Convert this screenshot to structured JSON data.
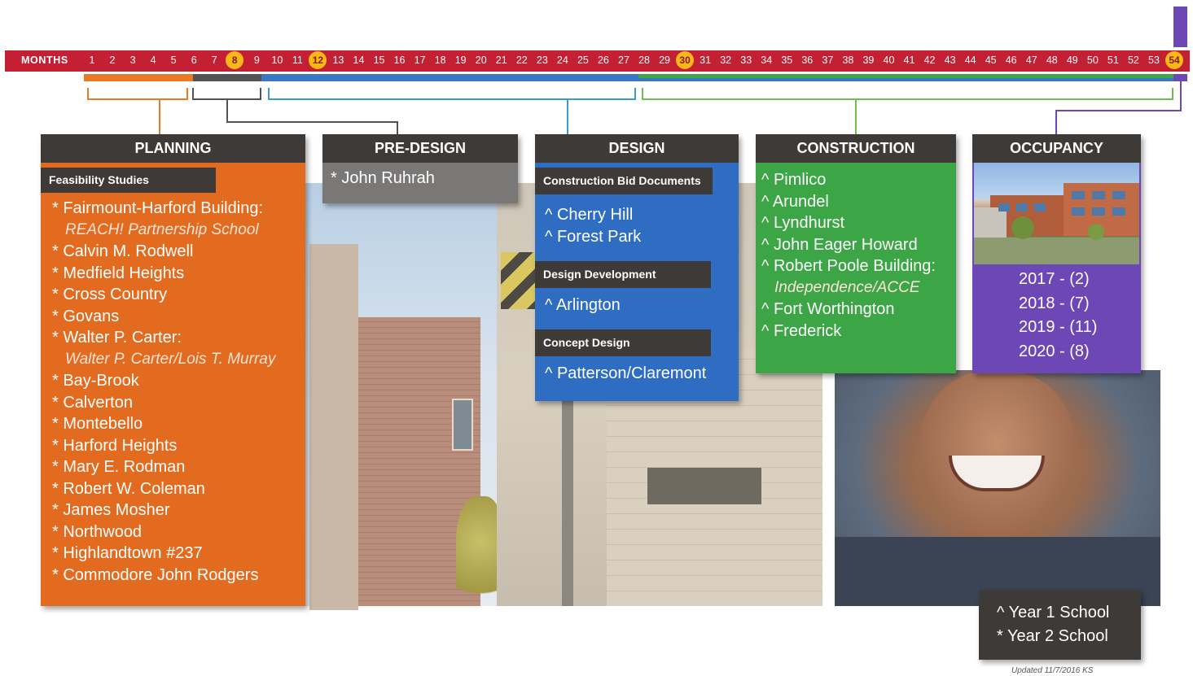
{
  "timeline": {
    "phases": [
      {
        "title": "PLANNING",
        "duration": "8 months",
        "color": "#ea7b24"
      },
      {
        "title": "PRE-DESIGN",
        "duration": "2-4 months",
        "color": "#545252"
      },
      {
        "title": "DESIGN",
        "duration": "12-18 months",
        "color": "#3a78c6"
      },
      {
        "title": "CONSTRUCTION - OCCUPANCY",
        "duration": "18-24 months",
        "color": "#3fa845"
      }
    ],
    "months_label": "MONTHS",
    "months": [
      "1",
      "2",
      "3",
      "4",
      "5",
      "6",
      "7",
      "8",
      "9",
      "10",
      "11",
      "12",
      "13",
      "14",
      "15",
      "16",
      "17",
      "18",
      "19",
      "20",
      "21",
      "22",
      "23",
      "24",
      "25",
      "26",
      "27",
      "28",
      "29",
      "30",
      "31",
      "32",
      "33",
      "34",
      "35",
      "36",
      "37",
      "38",
      "39",
      "40",
      "41",
      "42",
      "43",
      "44",
      "45",
      "46",
      "47",
      "48",
      "49",
      "50",
      "51",
      "52",
      "53",
      "54"
    ],
    "highlighted_months": [
      "8",
      "12",
      "30",
      "54"
    ]
  },
  "planning": {
    "title": "PLANNING",
    "subheading": "Feasibility Studies",
    "items": [
      {
        "text": "* Fairmount-Harford Building:",
        "italic": false
      },
      {
        "text": "REACH! Partnership School",
        "italic": true
      },
      {
        "text": "* Calvin M. Rodwell",
        "italic": false
      },
      {
        "text": "* Medfield Heights",
        "italic": false
      },
      {
        "text": "* Cross Country",
        "italic": false
      },
      {
        "text": "* Govans",
        "italic": false
      },
      {
        "text": "* Walter P. Carter:",
        "italic": false
      },
      {
        "text": "Walter P. Carter/Lois T. Murray",
        "italic": true
      },
      {
        "text": "* Bay-Brook",
        "italic": false
      },
      {
        "text": "* Calverton",
        "italic": false
      },
      {
        "text": "* Montebello",
        "italic": false
      },
      {
        "text": "* Harford  Heights",
        "italic": false
      },
      {
        "text": "* Mary E. Rodman",
        "italic": false
      },
      {
        "text": "* Robert W. Coleman",
        "italic": false
      },
      {
        "text": "* James Mosher",
        "italic": false
      },
      {
        "text": "* Northwood",
        "italic": false
      },
      {
        "text": "* Highlandtown #237",
        "italic": false
      },
      {
        "text": "* Commodore John Rodgers",
        "italic": false
      }
    ]
  },
  "predesign": {
    "title": "PRE-DESIGN",
    "items": [
      "* John Ruhrah"
    ]
  },
  "design": {
    "title": "DESIGN",
    "groups": [
      {
        "heading": "Construction Bid Documents",
        "items": [
          "^ Cherry Hill",
          "^ Forest Park"
        ]
      },
      {
        "heading": "Design Development",
        "items": [
          "^ Arlington"
        ]
      },
      {
        "heading": "Concept Design",
        "items": [
          "^ Patterson/Claremont"
        ]
      }
    ]
  },
  "construction": {
    "title": "CONSTRUCTION",
    "items": [
      {
        "text": "^ Pimlico",
        "italic": false
      },
      {
        "text": "^ Arundel",
        "italic": false
      },
      {
        "text": "^ Lyndhurst",
        "italic": false
      },
      {
        "text": "^ John Eager Howard",
        "italic": false
      },
      {
        "text": "^ Robert Poole Building:",
        "italic": false
      },
      {
        "text": "Independence/ACCE",
        "italic": true
      },
      {
        "text": "^ Fort Worthington",
        "italic": false
      },
      {
        "text": "^ Frederick",
        "italic": false
      }
    ]
  },
  "occupancy": {
    "title": "OCCUPANCY",
    "years": [
      "2017 - (2)",
      "2018 - (7)",
      "2019 - (11)",
      "2020 - (8)"
    ]
  },
  "legend": {
    "items": [
      "^  Year 1 School",
      "*  Year 2 School"
    ]
  },
  "updated": "Updated  11/7/2016  KS",
  "colors": {
    "planning": "#e36b1f",
    "predesign": "#7a7877",
    "design": "#2f6dc3",
    "construction": "#3ca646",
    "occupancy": "#6d47b5",
    "months_bar": "#c32034",
    "highlight": "#f7b818",
    "header": "#3d3a37"
  }
}
